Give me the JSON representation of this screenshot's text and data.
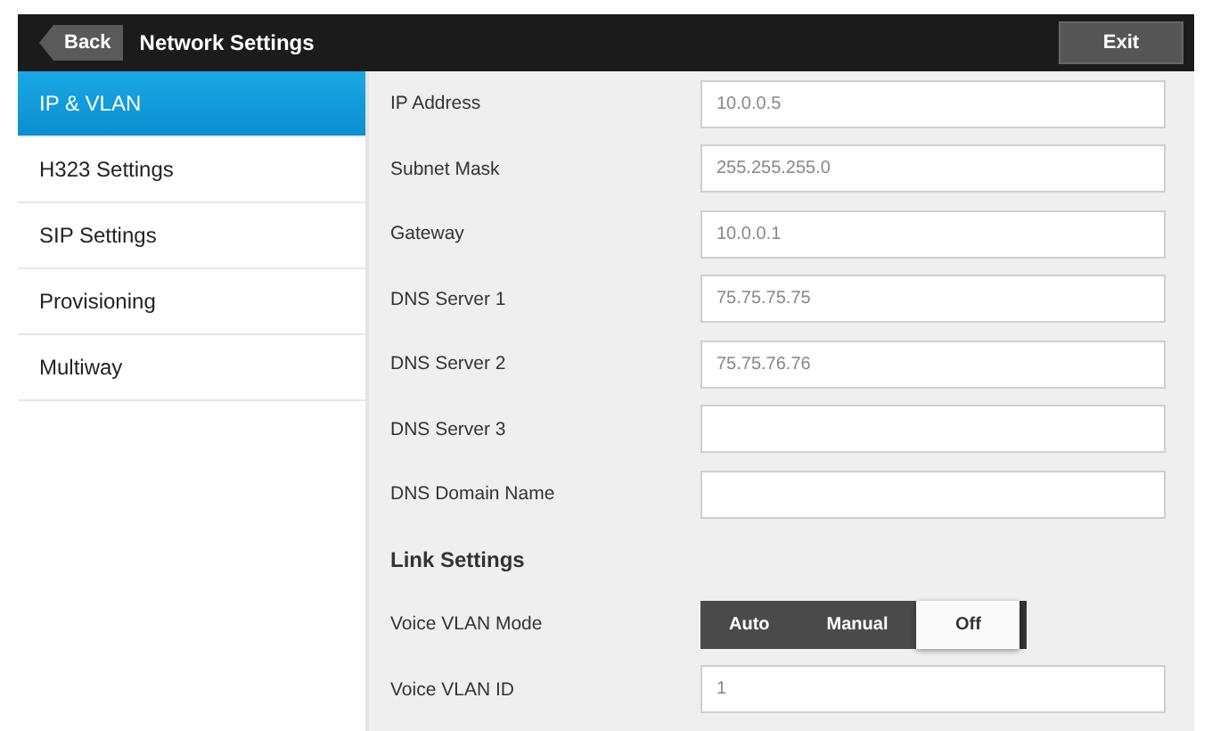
{
  "header": {
    "back": "Back",
    "title": "Network Settings",
    "exit": "Exit"
  },
  "sidebar": {
    "items": [
      {
        "label": "IP & VLAN",
        "selected": true
      },
      {
        "label": "H323 Settings",
        "selected": false
      },
      {
        "label": "SIP Settings",
        "selected": false
      },
      {
        "label": "Provisioning",
        "selected": false
      },
      {
        "label": "Multiway",
        "selected": false
      }
    ]
  },
  "rows": [
    {
      "kind": "field",
      "label": "IP Address",
      "value": "10.0.0.5"
    },
    {
      "kind": "field",
      "label": "Subnet Mask",
      "value": "255.255.255.0"
    },
    {
      "kind": "field",
      "label": "Gateway",
      "value": "10.0.0.1"
    },
    {
      "kind": "field",
      "label": "DNS Server 1",
      "value": "75.75.75.75"
    },
    {
      "kind": "field",
      "label": "DNS Server 2",
      "value": "75.75.76.76"
    },
    {
      "kind": "field",
      "label": "DNS Server 3"
    },
    {
      "kind": "field",
      "label": "DNS Domain Name"
    },
    {
      "kind": "heading",
      "label": "Link Settings"
    },
    {
      "kind": "segmented",
      "label": "Voice VLAN Mode",
      "options": [
        {
          "label": "Auto",
          "selected": false
        },
        {
          "label": "Manual",
          "selected": false
        },
        {
          "label": "Off",
          "selected": true
        }
      ]
    },
    {
      "kind": "field",
      "label": "Voice VLAN ID",
      "value": "1"
    }
  ]
}
